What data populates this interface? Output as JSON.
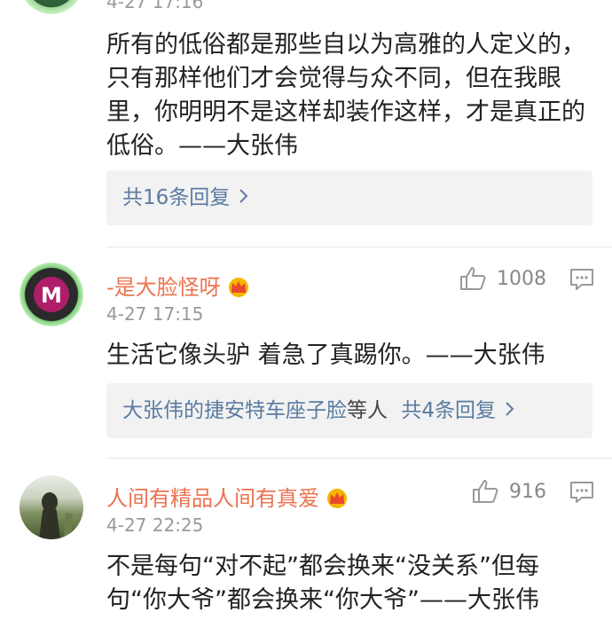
{
  "comment0": {
    "time": "4-27 17:16",
    "text": "所有的低俗都是那些自以为高雅的人定义的，只有那样他们才会觉得与众不同，但在我眼里，你明明不是这样却装作这样，才是真正的低俗。——大张伟",
    "reply_summary": "共16条回复"
  },
  "comment1": {
    "username": "-是大脸怪呀",
    "time": "4-27 17:15",
    "likes": "1008",
    "text": "生活它像头驴 着急了真踢你。——大张伟",
    "reply_author": "大张伟的捷安特车座子脸",
    "reply_mid": "等人",
    "reply_summary": "共4条回复"
  },
  "comment2": {
    "username": "人间有精品人间有真爱",
    "time": "4-27 22:25",
    "likes": "916",
    "text": "不是每句“对不起”都会换来“没关系”但每句“你大爷”都会换来“你大爷”——大张伟"
  },
  "colors": {
    "username": "#eb7350",
    "link": "#5a7ba0",
    "muted": "#999999",
    "reply_bg": "#f2f2f2"
  },
  "icons": [
    "crown-icon",
    "thumb-up-icon",
    "comment-icon",
    "chevron-right-icon"
  ]
}
